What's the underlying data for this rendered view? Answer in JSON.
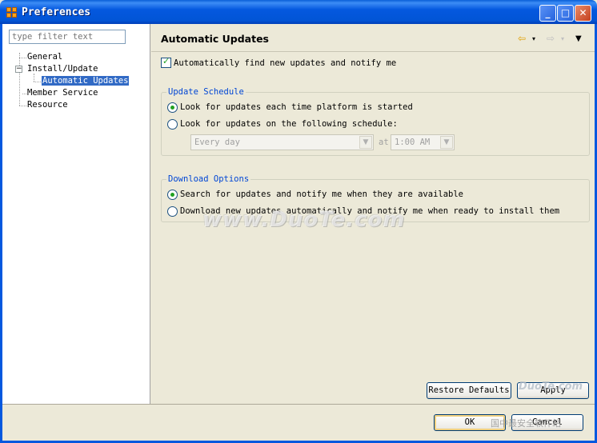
{
  "window": {
    "title": "Preferences",
    "buttons": {
      "minimize": "_",
      "maximize": "□",
      "close": "✕"
    }
  },
  "sidebar": {
    "filter_placeholder": "type filter text",
    "items": [
      {
        "label": "General",
        "level": 0
      },
      {
        "label": "Install/Update",
        "level": 0,
        "expanded": true
      },
      {
        "label": "Automatic Updates",
        "level": 1,
        "selected": true
      },
      {
        "label": "Member Service",
        "level": 0
      },
      {
        "label": "Resource",
        "level": 0
      }
    ]
  },
  "page": {
    "title": "Automatic Updates",
    "auto_find_label": "Automatically find new updates and notify me",
    "auto_find_checked": true
  },
  "schedule": {
    "title": "Update Schedule",
    "option_startup": "Look for updates each time platform is started",
    "option_schedule": "Look for updates on the following schedule:",
    "selected": "startup",
    "frequency_value": "Every day",
    "at_label": "at",
    "time_value": "1:00 AM"
  },
  "download": {
    "title": "Download Options",
    "option_notify": "Search for updates and notify me when they are available",
    "option_auto": "Download new updates automatically and notify me when ready to install them",
    "selected": "notify"
  },
  "buttons": {
    "restore_defaults": "Restore Defaults",
    "apply": "Apply",
    "ok": "OK",
    "cancel": "Cancel"
  },
  "watermarks": {
    "center": "www.DuoTe.com",
    "logo": "DuoTe.com",
    "logo_sub": "国中最安全软件站"
  },
  "icons": {
    "app": "preferences-icon",
    "back": "back-arrow-icon",
    "forward": "forward-arrow-icon",
    "menu": "view-menu-icon"
  },
  "colors": {
    "titlebar": "#0458df",
    "selection": "#316ac5",
    "group_title": "#0046d5",
    "check_mark": "#21a121"
  }
}
